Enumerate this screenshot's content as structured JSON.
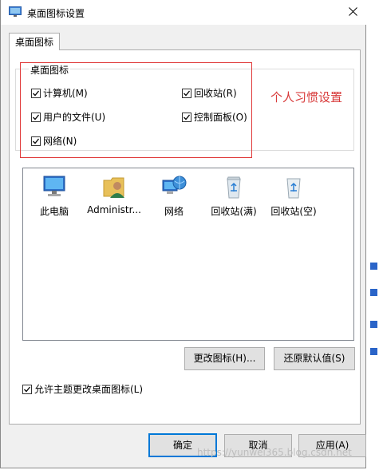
{
  "window": {
    "title": "桌面图标设置"
  },
  "tabs": [
    {
      "label": "桌面图标"
    }
  ],
  "group": {
    "legend": "桌面图标",
    "checkboxes": [
      {
        "label": "计算机(M)",
        "checked": true
      },
      {
        "label": "回收站(R)",
        "checked": true
      },
      {
        "label": "用户的文件(U)",
        "checked": true
      },
      {
        "label": "控制面板(O)",
        "checked": true
      },
      {
        "label": "网络(N)",
        "checked": true
      }
    ]
  },
  "annotation": "个人习惯设置",
  "icons": [
    {
      "label": "此电脑",
      "icon": "computer-icon"
    },
    {
      "label": "Administr...",
      "icon": "user-folder-icon"
    },
    {
      "label": "网络",
      "icon": "network-icon"
    },
    {
      "label": "回收站(满)",
      "icon": "recycle-bin-full-icon"
    },
    {
      "label": "回收站(空)",
      "icon": "recycle-bin-empty-icon"
    }
  ],
  "buttons": {
    "change_icon": "更改图标(H)...",
    "restore_default": "还原默认值(S)",
    "ok": "确定",
    "cancel": "取消",
    "apply": "应用(A)"
  },
  "theme_checkbox": {
    "label": "允许主题更改桌面图标(L)",
    "checked": true
  },
  "watermark": "https://yunwei365.blog.csdn.net",
  "colors": {
    "highlight": "#e03a3a",
    "accent": "#0078d7",
    "button_face": "#e1e1e1"
  }
}
